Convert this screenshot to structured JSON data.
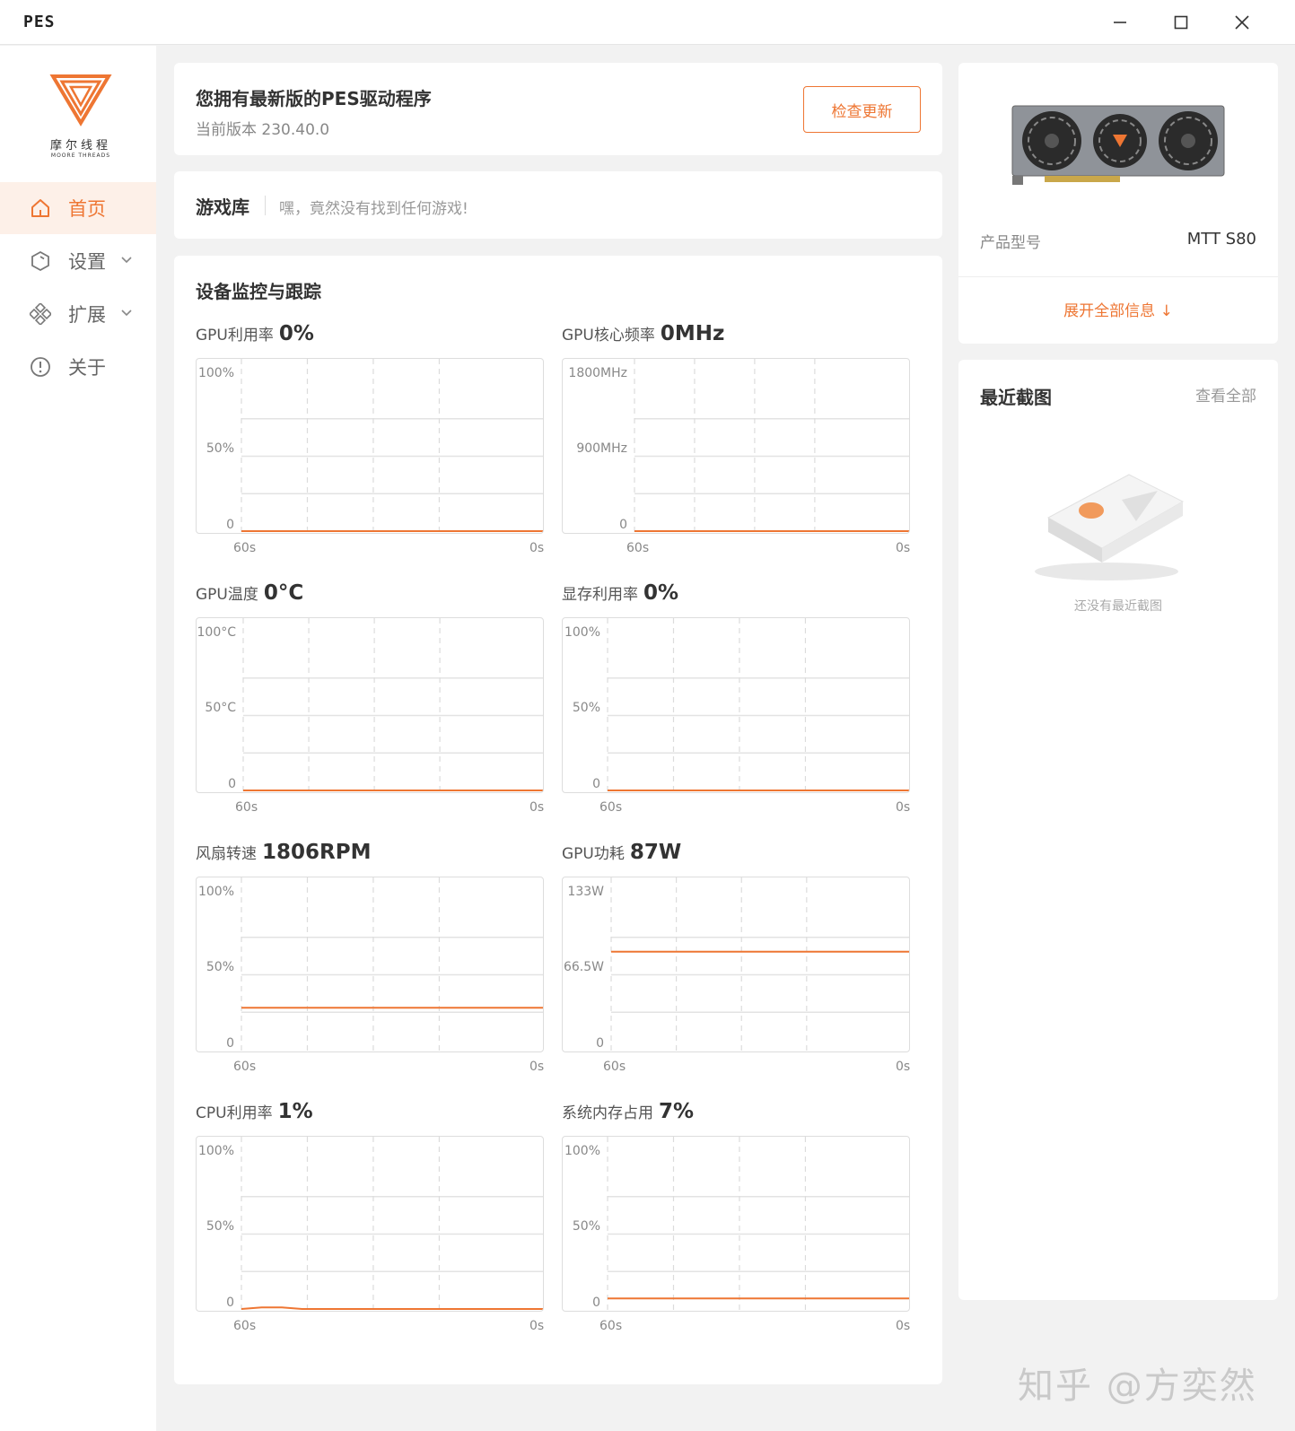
{
  "window": {
    "title": "PES",
    "controls": [
      "minimize-icon",
      "maximize-icon",
      "close-icon"
    ]
  },
  "brand": {
    "logo_cn": "摩尔线程",
    "logo_en": "MOORE THREADS",
    "accent": "#ee7633"
  },
  "sidebar": {
    "items": [
      {
        "label": "首页",
        "icon": "home-icon",
        "active": true
      },
      {
        "label": "设置",
        "icon": "settings-icon",
        "expandable": true
      },
      {
        "label": "扩展",
        "icon": "extensions-icon",
        "expandable": true
      },
      {
        "label": "关于",
        "icon": "info-icon"
      }
    ]
  },
  "update": {
    "title": "您拥有最新版的PES驱动程序",
    "version_text": "当前版本 230.40.0",
    "check_button": "检查更新"
  },
  "library": {
    "title": "游戏库",
    "message": "嘿，竟然没有找到任何游戏!"
  },
  "monitor": {
    "title": "设备监控与跟踪",
    "metrics": [
      {
        "label": "GPU利用率",
        "value": "0%",
        "yticks": [
          "100%",
          "50%",
          "0"
        ],
        "xticks": [
          "60s",
          "0s"
        ]
      },
      {
        "label": "GPU核心频率",
        "value": "0MHz",
        "yticks": [
          "1800MHz",
          "900MHz",
          "0"
        ],
        "xticks": [
          "60s",
          "0s"
        ]
      },
      {
        "label": "GPU温度",
        "value": "0°C",
        "yticks": [
          "100°C",
          "50°C",
          "0"
        ],
        "xticks": [
          "60s",
          "0s"
        ]
      },
      {
        "label": "显存利用率",
        "value": "0%",
        "yticks": [
          "100%",
          "50%",
          "0"
        ],
        "xticks": [
          "60s",
          "0s"
        ]
      },
      {
        "label": "风扇转速",
        "value": "1806RPM",
        "yticks": [
          "100%",
          "50%",
          "0"
        ],
        "xticks": [
          "60s",
          "0s"
        ]
      },
      {
        "label": "GPU功耗",
        "value": "87W",
        "yticks": [
          "133W",
          "66.5W",
          "0"
        ],
        "xticks": [
          "60s",
          "0s"
        ]
      },
      {
        "label": "CPU利用率",
        "value": "1%",
        "yticks": [
          "100%",
          "50%",
          "0"
        ],
        "xticks": [
          "60s",
          "0s"
        ]
      },
      {
        "label": "系统内存占用",
        "value": "7%",
        "yticks": [
          "100%",
          "50%",
          "0"
        ],
        "xticks": [
          "60s",
          "0s"
        ]
      }
    ]
  },
  "chart_data": [
    {
      "type": "line",
      "title": "GPU利用率",
      "x": [
        60,
        0
      ],
      "ylim": [
        0,
        100
      ],
      "series": [
        {
          "values": [
            0,
            0
          ]
        }
      ],
      "grid": true
    },
    {
      "type": "line",
      "title": "GPU核心频率",
      "x": [
        60,
        0
      ],
      "ylim": [
        0,
        1800
      ],
      "series": [
        {
          "values": [
            0,
            0
          ]
        }
      ],
      "grid": true
    },
    {
      "type": "line",
      "title": "GPU温度",
      "x": [
        60,
        0
      ],
      "ylim": [
        0,
        100
      ],
      "series": [
        {
          "values": [
            0,
            0
          ]
        }
      ],
      "grid": true
    },
    {
      "type": "line",
      "title": "显存利用率",
      "x": [
        60,
        0
      ],
      "ylim": [
        0,
        100
      ],
      "series": [
        {
          "values": [
            0,
            0
          ]
        }
      ],
      "grid": true
    },
    {
      "type": "line",
      "title": "风扇转速",
      "x": [
        60,
        0
      ],
      "ylim": [
        0,
        100
      ],
      "series": [
        {
          "values": [
            28,
            28
          ]
        }
      ],
      "grid": true
    },
    {
      "type": "line",
      "title": "GPU功耗",
      "x": [
        60,
        0
      ],
      "ylim": [
        0,
        133
      ],
      "series": [
        {
          "values": [
            87,
            87
          ]
        }
      ],
      "grid": true
    },
    {
      "type": "line",
      "title": "CPU利用率",
      "x": [
        60,
        56,
        52,
        48,
        44,
        40,
        0
      ],
      "ylim": [
        0,
        100
      ],
      "series": [
        {
          "values": [
            0,
            1,
            1,
            0,
            0,
            0,
            0
          ]
        }
      ],
      "grid": true
    },
    {
      "type": "line",
      "title": "系统内存占用",
      "x": [
        60,
        0
      ],
      "ylim": [
        0,
        100
      ],
      "series": [
        {
          "values": [
            7,
            7
          ]
        }
      ],
      "grid": true
    }
  ],
  "device": {
    "model_label": "产品型号",
    "model_value": "MTT S80",
    "expand_link": "展开全部信息 ↓"
  },
  "screenshots": {
    "title": "最近截图",
    "view_all": "查看全部",
    "empty_text": "还没有最近截图"
  },
  "watermark": "知乎 @方奕然"
}
